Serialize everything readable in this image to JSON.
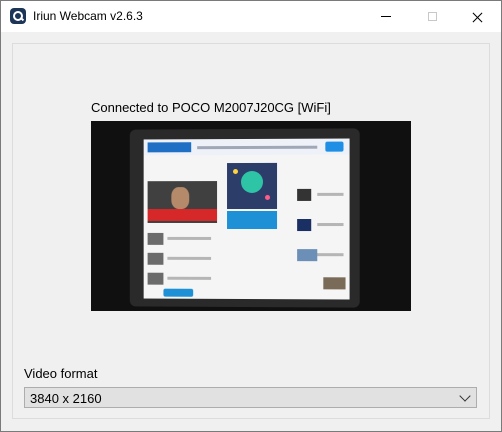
{
  "window": {
    "title": "Iriun Webcam v2.6.3"
  },
  "status": {
    "text": "Connected to POCO M2007J20CG [WiFi]"
  },
  "video_format": {
    "label": "Video format",
    "selected": "3840 x 2160"
  }
}
